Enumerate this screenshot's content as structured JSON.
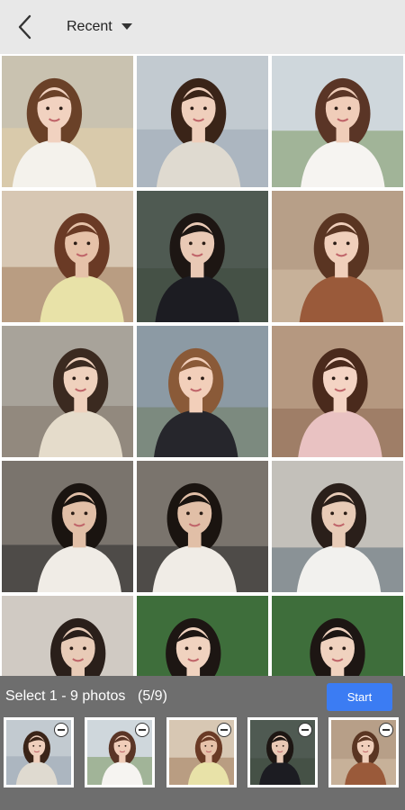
{
  "header": {
    "back_icon": "chevron-left-icon",
    "album_label": "Recent",
    "dropdown_icon": "caret-down-icon"
  },
  "grid": {
    "photos": [
      {
        "bg": "#c9c2b0",
        "hair": "#6a4128",
        "skin": "#f1d2c0",
        "cloth": "#f4f2ec",
        "accent": "#e6d2a8"
      },
      {
        "bg": "#c2cad0",
        "hair": "#3a2418",
        "skin": "#efcfbc",
        "cloth": "#dfdad0",
        "accent": "#9aa6b2"
      },
      {
        "bg": "#cfd7dc",
        "hair": "#5a3526",
        "skin": "#f0cdb9",
        "cloth": "#f6f4f1",
        "accent": "#7b9860"
      },
      {
        "bg": "#d7c7b3",
        "hair": "#6a3a25",
        "skin": "#e6c2a9",
        "cloth": "#e8e2a8",
        "accent": "#a07a5a"
      },
      {
        "bg": "#4f5a52",
        "hair": "#1d1613",
        "skin": "#e9c9b5",
        "cloth": "#1c1c22",
        "accent": "#3e4a3d"
      },
      {
        "bg": "#b79f88",
        "hair": "#5a3522",
        "skin": "#f0cfbb",
        "cloth": "#9a5a3a",
        "accent": "#d6c0a8"
      },
      {
        "bg": "#a8a39a",
        "hair": "#3b2a20",
        "skin": "#efd1bd",
        "cloth": "#e5dccb",
        "accent": "#7f7467"
      },
      {
        "bg": "#8c9aa4",
        "hair": "#8a5a38",
        "skin": "#f2cfba",
        "cloth": "#26262c",
        "accent": "#6f7d60"
      },
      {
        "bg": "#b59880",
        "hair": "#4a2a1c",
        "skin": "#f4d4c4",
        "cloth": "#e9c2c2",
        "accent": "#8d6a52"
      },
      {
        "bg": "#7a746d",
        "hair": "#1a1410",
        "skin": "#e1bfa7",
        "cloth": "#f0ece6",
        "accent": "#2a2a2a"
      },
      {
        "bg": "#7a746d",
        "hair": "#1a1410",
        "skin": "#e1bfa7",
        "cloth": "#f0ece6",
        "accent": "#2a2a2a"
      },
      {
        "bg": "#c3c0ba",
        "hair": "#2a1f1a",
        "skin": "#e8cbb7",
        "cloth": "#f2f1ee",
        "accent": "#5b6b78"
      },
      {
        "bg": "#d0cac3",
        "hair": "#2a1f1a",
        "skin": "#e8cbb7",
        "cloth": "#eeeeec",
        "accent": "#5b6b78"
      },
      {
        "bg": "#3e6e3b",
        "hair": "#1d1613",
        "skin": "#f0d2bf",
        "cloth": "#1e1e24",
        "accent": "#5a8a4a"
      },
      {
        "bg": "#3e6e3b",
        "hair": "#1d1613",
        "skin": "#f0d2bf",
        "cloth": "#1e1e24",
        "accent": "#5a8a4a"
      }
    ]
  },
  "panel": {
    "select_label": "Select 1 - 9 photos",
    "count_label": "(5/9)",
    "start_label": "Start",
    "accent_color": "#3b7cf3",
    "selected": [
      {
        "bg": "#c2cad0",
        "hair": "#3a2418",
        "skin": "#efcfbc",
        "cloth": "#dfdad0",
        "accent": "#9aa6b2"
      },
      {
        "bg": "#cfd7dc",
        "hair": "#5a3526",
        "skin": "#f0cdb9",
        "cloth": "#f6f4f1",
        "accent": "#7b9860"
      },
      {
        "bg": "#d7c7b3",
        "hair": "#6a3a25",
        "skin": "#e6c2a9",
        "cloth": "#e8e2a8",
        "accent": "#a07a5a"
      },
      {
        "bg": "#4f5a52",
        "hair": "#1d1613",
        "skin": "#e9c9b5",
        "cloth": "#1c1c22",
        "accent": "#3e4a3d"
      },
      {
        "bg": "#b79f88",
        "hair": "#5a3522",
        "skin": "#f0cfbb",
        "cloth": "#9a5a3a",
        "accent": "#d6c0a8"
      }
    ]
  }
}
